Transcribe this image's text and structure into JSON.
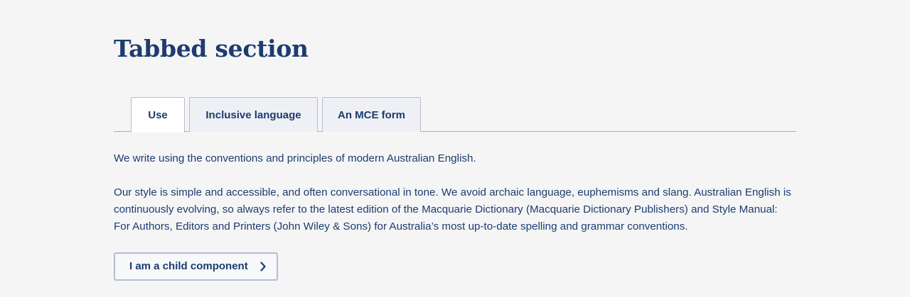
{
  "section": {
    "title": "Tabbed section"
  },
  "tabs": [
    {
      "label": "Use",
      "active": true
    },
    {
      "label": "Inclusive language",
      "active": false
    },
    {
      "label": "An MCE form",
      "active": false
    }
  ],
  "panel": {
    "paragraph_1": "We write using the conventions and principles of modern Australian English.",
    "paragraph_2": "Our style is simple and accessible, and often conversational in tone. We avoid archaic language, euphemisms and slang. Australian English is continuously evolving, so always refer to the latest edition of the Macquarie Dictionary (Macquarie Dictionary Publishers) and Style Manual: For Authors, Editors and Printers (John Wiley & Sons) for Australia’s most up-to-date spelling and grammar conventions.",
    "child_button_label": "I am a child component",
    "child_button_icon": "chevron-right-icon"
  },
  "colors": {
    "text": "#1d3c6e",
    "background": "#f5f5f6",
    "border": "#b5bdd1"
  }
}
